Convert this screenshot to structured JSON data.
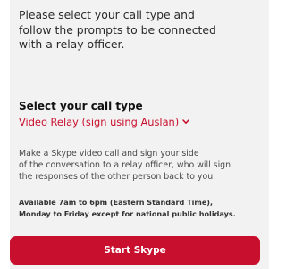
{
  "intro": {
    "line1": "Please select your call type and",
    "line2": "follow the prompts to be connected",
    "line3": "with a relay officer."
  },
  "call_type": {
    "heading": "Select your call type",
    "selected": "Video Relay (sign using Auslan)"
  },
  "description": {
    "line1": "Make a Skype video call and sign your side",
    "line2": "of the conversation to a relay officer, who will sign",
    "line3": "the responses of the other person back to you."
  },
  "hours": {
    "line1": "Available 7am to 6pm (Eastern Standard Time),",
    "line2": "Monday to Friday except for national public holidays."
  },
  "actions": {
    "start_label": "Start Skype"
  },
  "colors": {
    "accent": "#c8102e",
    "panel_background": "#f3f2f2"
  },
  "icons": {
    "dropdown": "chevron-down-icon"
  }
}
